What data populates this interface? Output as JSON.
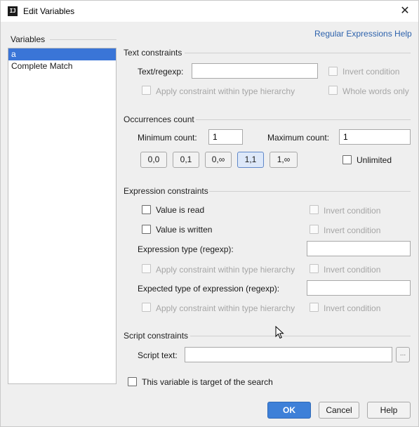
{
  "window": {
    "title": "Edit Variables",
    "app_icon": "IJ",
    "close_glyph": "✕"
  },
  "variables": {
    "header": "Variables",
    "items": [
      {
        "label": "a",
        "selected": true
      },
      {
        "label": "Complete Match",
        "selected": false
      }
    ]
  },
  "help_link": "Regular Expressions Help",
  "text_constraints": {
    "header": "Text constraints",
    "text_regexp_label": "Text/regexp:",
    "text_regexp_value": "",
    "invert_condition": "Invert condition",
    "apply_hierarchy": "Apply constraint within type hierarchy",
    "whole_words": "Whole words only"
  },
  "occurrences": {
    "header": "Occurrences count",
    "min_label": "Minimum count:",
    "min_value": "1",
    "max_label": "Maximum count:",
    "max_value": "1",
    "presets": [
      "0,0",
      "0,1",
      "0,∞",
      "1,1",
      "1,∞"
    ],
    "selected_preset": "1,1",
    "unlimited_label": "Unlimited"
  },
  "expression_constraints": {
    "header": "Expression constraints",
    "value_is_read": "Value is read",
    "value_is_written": "Value is written",
    "invert_condition": "Invert condition",
    "expression_type_label": "Expression type (regexp):",
    "expression_type_value": "",
    "apply_hierarchy": "Apply constraint within type hierarchy",
    "expected_type_label": "Expected type of expression (regexp):",
    "expected_type_value": ""
  },
  "script_constraints": {
    "header": "Script constraints",
    "script_text_label": "Script text:",
    "script_text_value": "",
    "browse_glyph": "..."
  },
  "target_label": "This variable is target of the search",
  "buttons": {
    "ok": "OK",
    "cancel": "Cancel",
    "help": "Help"
  },
  "colors": {
    "accent": "#3a75d7",
    "link": "#2d62ac",
    "ok_button": "#3e80d8"
  }
}
